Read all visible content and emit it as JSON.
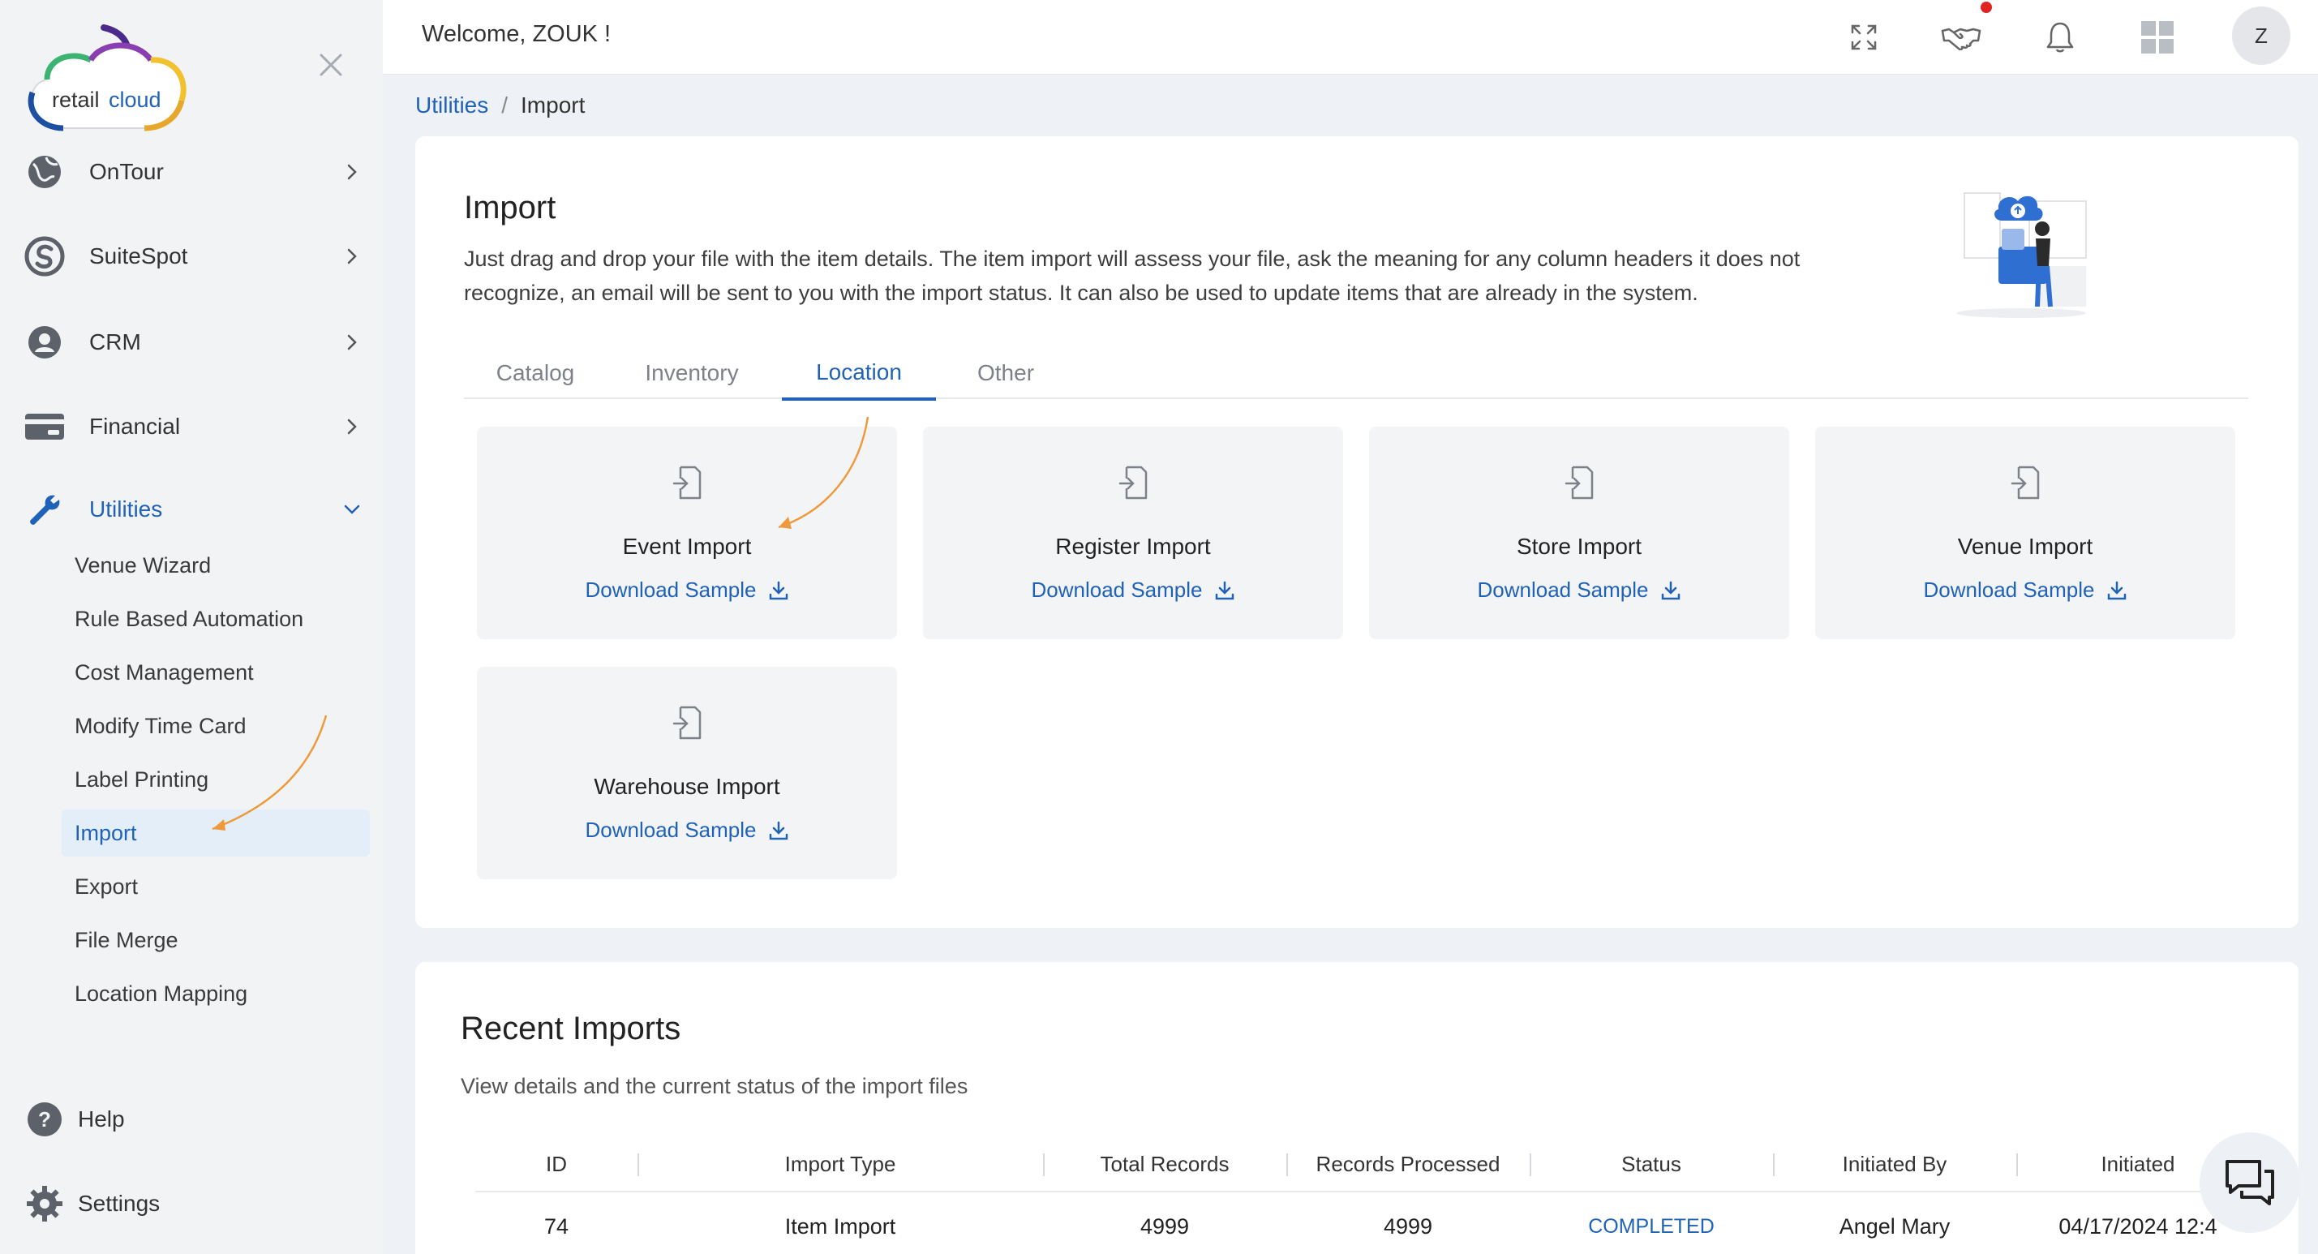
{
  "colors": {
    "accent": "#1f62b7",
    "annotation_arrow": "#ef9a3a",
    "notification_dot": "#e02424"
  },
  "logo": {
    "text_retail": "retail",
    "text_cloud": "cloud"
  },
  "sidebar": {
    "nav": [
      {
        "label": "OnTour",
        "icon": "globe-icon"
      },
      {
        "label": "SuiteSpot",
        "icon": "suitespot-icon"
      },
      {
        "label": "CRM",
        "icon": "crm-gear-icon"
      },
      {
        "label": "Financial",
        "icon": "credit-card-icon"
      },
      {
        "label": "Utilities",
        "icon": "wrench-icon"
      }
    ],
    "utilities_items": [
      "Venue Wizard",
      "Rule Based Automation",
      "Cost Management",
      "Modify Time Card",
      "Label Printing",
      "Import",
      "Export",
      "File Merge",
      "Location Mapping"
    ],
    "active_sub_item": "Import",
    "bottom": [
      {
        "label": "Help",
        "icon": "help-icon"
      },
      {
        "label": "Settings",
        "icon": "settings-gear-icon"
      }
    ]
  },
  "header": {
    "welcome": "Welcome, ZOUK !",
    "avatar_initial": "Z",
    "icons": [
      "fullscreen-icon",
      "handshake-icon",
      "bell-icon",
      "grid-apps-icon"
    ]
  },
  "breadcrumb": {
    "parent": "Utilities",
    "separator": "/",
    "current": "Import"
  },
  "import": {
    "title": "Import",
    "description": "Just drag and drop your file with the item details. The item import will assess your file, ask the meaning for any column headers it does not recognize, an email will be sent to you with the import status. It can also be used to update items that are already in the system.",
    "tabs": [
      "Catalog",
      "Inventory",
      "Location",
      "Other"
    ],
    "active_tab": "Location",
    "tiles": [
      {
        "title": "Event Import",
        "link": "Download Sample"
      },
      {
        "title": "Register Import",
        "link": "Download Sample"
      },
      {
        "title": "Store Import",
        "link": "Download Sample"
      },
      {
        "title": "Venue Import",
        "link": "Download Sample"
      },
      {
        "title": "Warehouse Import",
        "link": "Download Sample"
      }
    ]
  },
  "recent": {
    "title": "Recent Imports",
    "subtitle": "View details and the current status of the import files",
    "columns": [
      "ID",
      "Import Type",
      "Total Records",
      "Records Processed",
      "Status",
      "Initiated By",
      "Initiated"
    ],
    "rows": [
      {
        "id": "74",
        "type": "Item Import",
        "total": "4999",
        "processed": "4999",
        "status": "COMPLETED",
        "by": "Angel Mary",
        "initiated": "04/17/2024 12:4"
      }
    ]
  }
}
